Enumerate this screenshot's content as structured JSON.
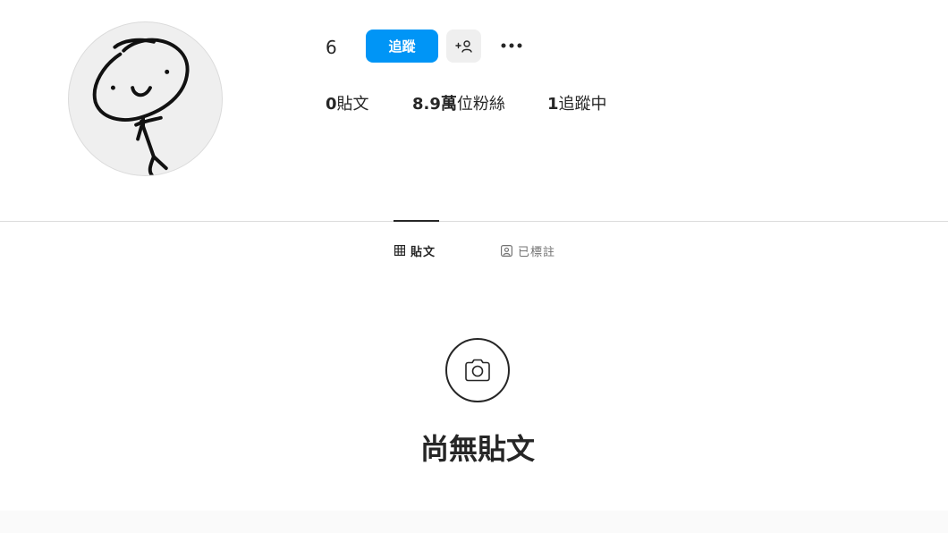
{
  "profile": {
    "username": "6",
    "avatar_alt": "profile-avatar"
  },
  "actions": {
    "follow_label": "追蹤",
    "suggest_icon": "add-person-icon",
    "more_icon": "more-horizontal-icon"
  },
  "stats": {
    "posts_count": "0",
    "posts_label": "貼文",
    "followers_count": "8.9萬",
    "followers_label": "位粉絲",
    "following_count": "1",
    "following_label": "追蹤中"
  },
  "tabs": [
    {
      "label": "貼文",
      "icon": "grid-icon",
      "active": true
    },
    {
      "label": "已標註",
      "icon": "tagged-icon",
      "active": false
    }
  ],
  "empty_state": {
    "icon": "camera-icon",
    "message": "尚無貼文"
  },
  "colors": {
    "accent": "#0095f6",
    "text": "#262626",
    "muted": "#737373",
    "border": "#dbdbdb",
    "secondary_bg": "#efefef"
  }
}
